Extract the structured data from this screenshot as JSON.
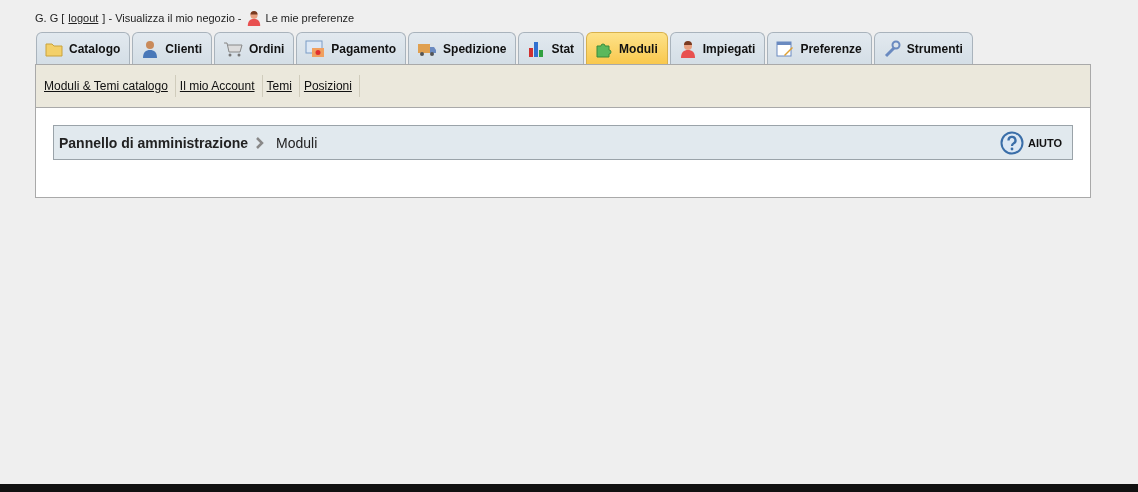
{
  "header": {
    "user": "G. G [",
    "logout": "logout",
    "after_logout": "] - Visualizza il mio negozio -",
    "preferences": "Le mie preferenze"
  },
  "tabs": [
    {
      "label": "Catalogo",
      "selected": false
    },
    {
      "label": "Clienti",
      "selected": false
    },
    {
      "label": "Ordini",
      "selected": false
    },
    {
      "label": "Pagamento",
      "selected": false
    },
    {
      "label": "Spedizione",
      "selected": false
    },
    {
      "label": "Stat",
      "selected": false
    },
    {
      "label": "Moduli",
      "selected": true
    },
    {
      "label": "Impiegati",
      "selected": false
    },
    {
      "label": "Preferenze",
      "selected": false
    },
    {
      "label": "Strumenti",
      "selected": false
    }
  ],
  "subtabs": [
    "Moduli & Temi catalogo",
    "Il mio Account",
    "Temi",
    "Posizioni"
  ],
  "breadcrumb": {
    "root": "Pannello di amministrazione",
    "current": "Moduli"
  },
  "help": "AIUTO"
}
